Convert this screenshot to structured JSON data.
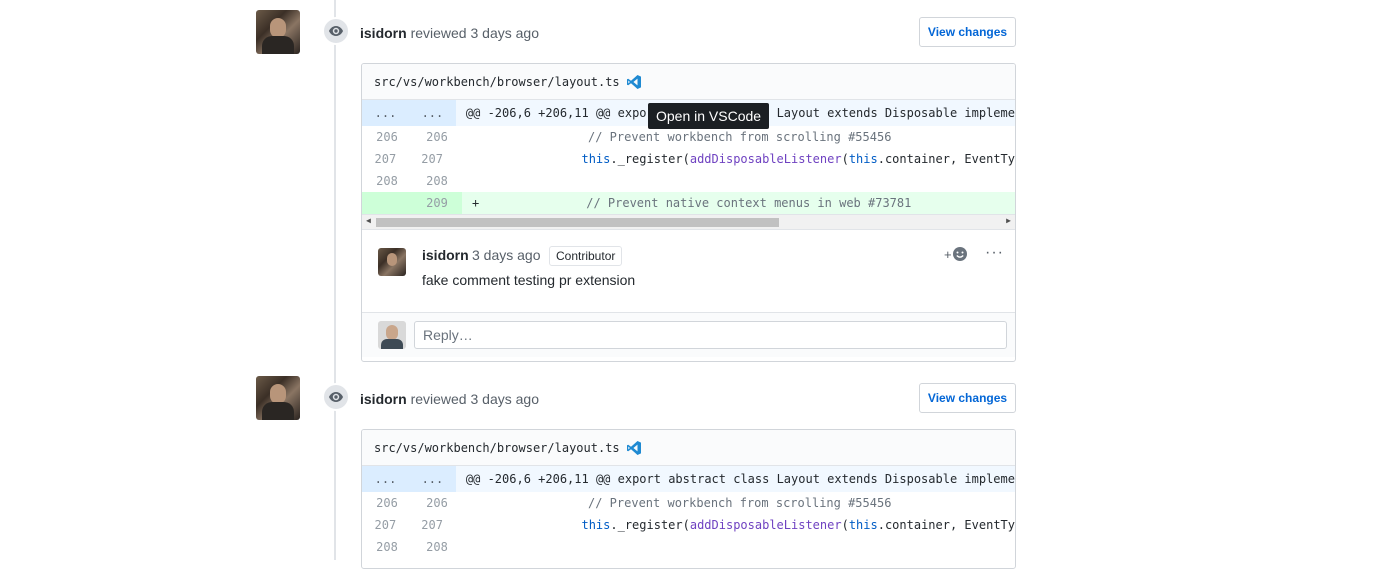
{
  "events": [
    {
      "user": "isidorn",
      "action": "reviewed",
      "time": "3 days ago",
      "view_changes": "View changes",
      "file_path": "src/vs/workbench/browser/layout.ts",
      "hunk": "@@ -206,6 +206,11 @@ export abstract class Layout extends Disposable impleme",
      "lines": [
        {
          "old": "206",
          "new": "206",
          "code": "// Prevent workbench from scrolling #55456"
        },
        {
          "old": "207",
          "new": "207",
          "code_parts": [
            "this",
            "._register(",
            "addDisposableListener",
            "(",
            "this",
            ".container, EventTy"
          ]
        },
        {
          "old": "208",
          "new": "208",
          "code": ""
        },
        {
          "old": "",
          "new": "209",
          "prefix": "+",
          "code": "// Prevent native context menus in web #73781"
        }
      ],
      "comment": {
        "author": "isidorn",
        "time": "3 days ago",
        "badge": "Contributor",
        "body": "fake comment testing pr extension",
        "react_label": "+",
        "more_label": "···"
      },
      "reply_placeholder": "Reply…"
    },
    {
      "user": "isidorn",
      "action": "reviewed",
      "time": "3 days ago",
      "view_changes": "View changes",
      "file_path": "src/vs/workbench/browser/layout.ts",
      "hunk": "@@ -206,6 +206,11 @@ export abstract class Layout extends Disposable impleme",
      "lines": [
        {
          "old": "206",
          "new": "206",
          "code": "// Prevent workbench from scrolling #55456"
        },
        {
          "old": "207",
          "new": "207",
          "code_parts": [
            "this",
            "._register(",
            "addDisposableListener",
            "(",
            "this",
            ".container, EventTy"
          ]
        },
        {
          "old": "208",
          "new": "208",
          "code": ""
        }
      ]
    }
  ],
  "hunk_marker": "...",
  "tooltip": "Open in VSCode",
  "icons": {
    "timeline_badge": "eye-icon",
    "file_action": "vscode-icon",
    "reaction": "smiley-icon",
    "more": "kebab-icon"
  }
}
